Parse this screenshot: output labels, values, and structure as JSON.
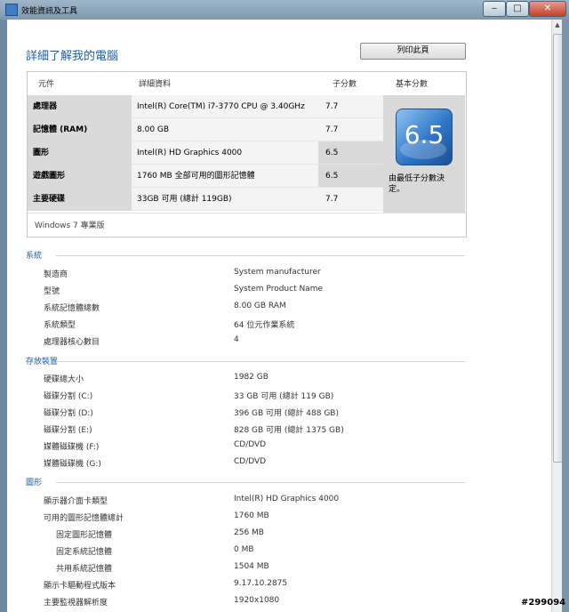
{
  "window": {
    "title": "效能資訊及工具",
    "min_label": "‒",
    "max_label": "□",
    "close_label": "✕"
  },
  "page": {
    "heading": "詳細了解我的電腦",
    "print_button": "列印此頁"
  },
  "score_table": {
    "headers": {
      "component": "元件",
      "details": "詳細資料",
      "subscore": "子分數",
      "base": "基本分數"
    },
    "rows": [
      {
        "component": "處理器",
        "details": "Intel(R) Core(TM) i7-3770 CPU @ 3.40GHz",
        "subscore": "7.7"
      },
      {
        "component": "記憶體 (RAM)",
        "details": "8.00 GB",
        "subscore": "7.7"
      },
      {
        "component": "圖形",
        "details": "Intel(R) HD Graphics 4000",
        "subscore": "6.5"
      },
      {
        "component": "遊戲圖形",
        "details": "1760 MB 全部可用的圖形記憶體",
        "subscore": "6.5"
      },
      {
        "component": "主要硬碟",
        "details": "33GB 可用 (總計 119GB)",
        "subscore": "7.7"
      }
    ],
    "base_score": "6.5",
    "base_note": "由最低子分數決定。",
    "edition": "Windows 7 專業版"
  },
  "system": {
    "title": "系統",
    "items": [
      {
        "label": "製造商",
        "value": "System manufacturer"
      },
      {
        "label": "型號",
        "value": "System Product Name"
      },
      {
        "label": "系統記憶體總數",
        "value": "8.00 GB RAM"
      },
      {
        "label": "系統類型",
        "value": "64 位元作業系統"
      },
      {
        "label": "處理器核心數目",
        "value": "4"
      }
    ]
  },
  "storage": {
    "title": "存放裝置",
    "items": [
      {
        "label": "硬碟總大小",
        "value": "1982 GB"
      },
      {
        "label": "磁碟分割 (C:)",
        "value": "33 GB 可用 (總計 119 GB)"
      },
      {
        "label": "磁碟分割 (D:)",
        "value": "396 GB 可用 (總計 488 GB)"
      },
      {
        "label": "磁碟分割 (E:)",
        "value": "828 GB 可用 (總計 1375 GB)"
      },
      {
        "label": "媒體磁碟機 (F:)",
        "value": "CD/DVD"
      },
      {
        "label": "媒體磁碟機 (G:)",
        "value": "CD/DVD"
      }
    ]
  },
  "graphics": {
    "title": "圖形",
    "items": [
      {
        "label": "顯示器介面卡類型",
        "value": "Intel(R) HD Graphics 4000"
      },
      {
        "label": "可用的圖形記憶體總計",
        "value": "1760 MB"
      },
      {
        "label": "固定圖形記憶體",
        "value": "256 MB"
      },
      {
        "label": "固定系統記憶體",
        "value": "0 MB"
      },
      {
        "label": "共用系統記憶體",
        "value": "1504 MB"
      },
      {
        "label": "顯示卡驅動程式版本",
        "value": "9.17.10.2875"
      },
      {
        "label": "主要監視器解析度",
        "value": "1920x1080"
      }
    ]
  },
  "watermark": "#299094",
  "colors": {
    "accent": "#1e5fa8",
    "score_highlight": "#d9d9d9"
  }
}
